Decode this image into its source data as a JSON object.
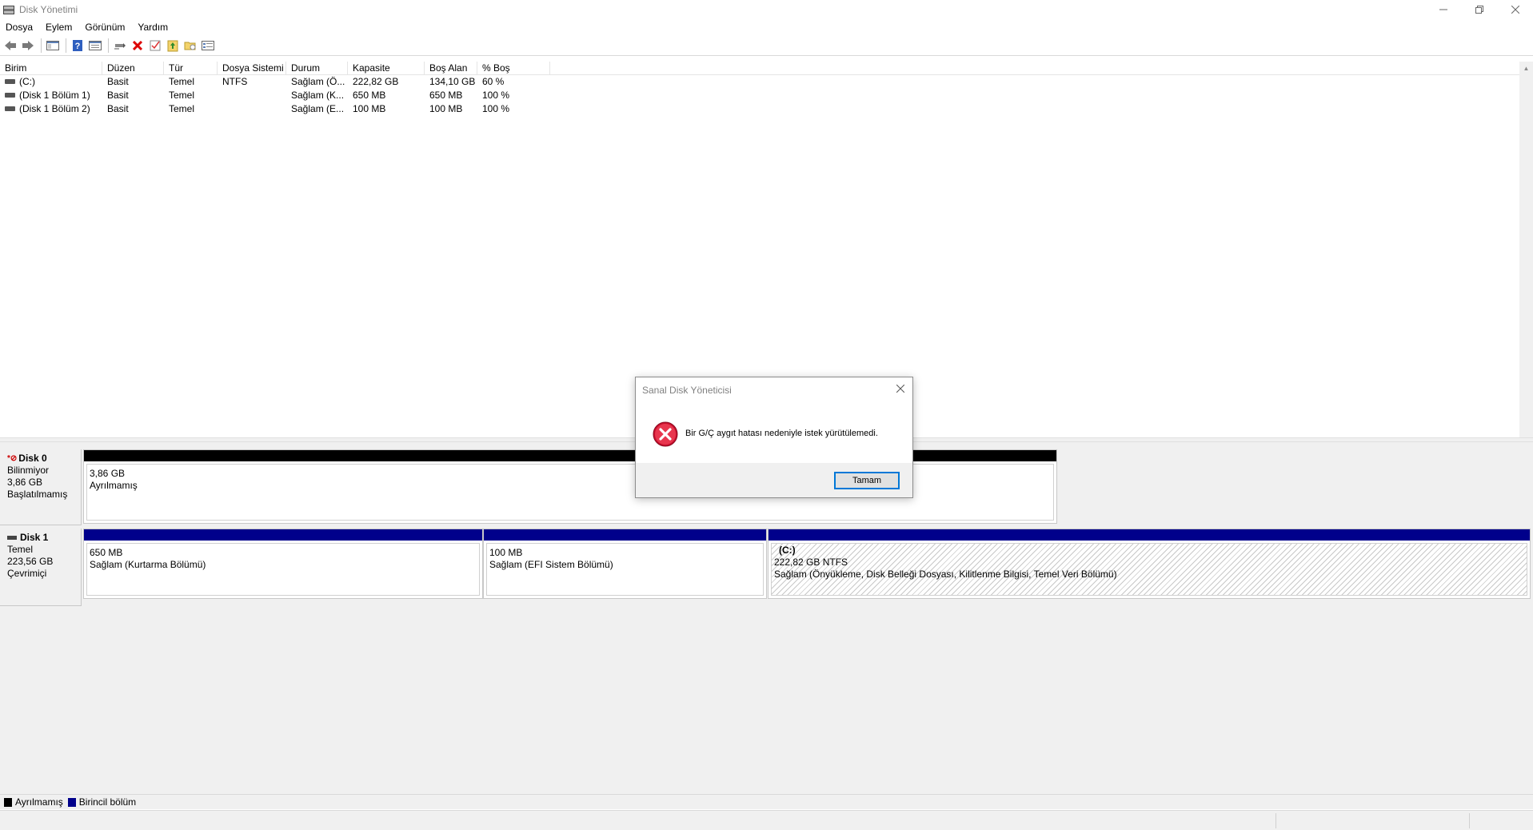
{
  "window": {
    "title": "Disk Yönetimi"
  },
  "menu": [
    "Dosya",
    "Eylem",
    "Görünüm",
    "Yardım"
  ],
  "toolbar": {
    "icons": [
      "back-arrow-icon",
      "forward-arrow-icon",
      "console-tree-icon",
      "help-icon",
      "properties-icon",
      "connect-icon",
      "delete-icon",
      "check-icon",
      "export-icon",
      "folder-icon",
      "list-view-icon"
    ]
  },
  "volume_list": {
    "columns": [
      "Birim",
      "Düzen",
      "Tür",
      "Dosya Sistemi",
      "Durum",
      "Kapasite",
      "Boş Alan",
      "% Boş"
    ],
    "rows": [
      [
        "(C:)",
        "Basit",
        "Temel",
        "NTFS",
        "Sağlam (Ö...",
        "222,82 GB",
        "134,10 GB",
        "60 %"
      ],
      [
        "(Disk 1 Bölüm 1)",
        "Basit",
        "Temel",
        "",
        "Sağlam (K...",
        "650 MB",
        "650 MB",
        "100 %"
      ],
      [
        "(Disk 1 Bölüm 2)",
        "Basit",
        "Temel",
        "",
        "Sağlam (E...",
        "100 MB",
        "100 MB",
        "100 %"
      ]
    ]
  },
  "disks": [
    {
      "name": "Disk 0",
      "type": "Bilinmiyor",
      "size": "3,86 GB",
      "status": "Başlatılmamış",
      "partitions": [
        {
          "size": "3,86 GB",
          "label": "Ayrılmamış",
          "bar_color": "#000000"
        }
      ]
    },
    {
      "name": "Disk 1",
      "type": "Temel",
      "size": "223,56 GB",
      "status": "Çevrimiçi",
      "partitions": [
        {
          "size": "650 MB",
          "label": "Sağlam (Kurtarma Bölümü)",
          "bar_color": "#00008b"
        },
        {
          "size": "100 MB",
          "label": "Sağlam (EFI Sistem Bölümü)",
          "bar_color": "#00008b"
        },
        {
          "name": "(C:)",
          "size": "222,82 GB NTFS",
          "label": "Sağlam (Önyükleme, Disk Belleği Dosyası, Kilitlenme Bilgisi, Temel Veri Bölümü)",
          "bar_color": "#00008b"
        }
      ]
    }
  ],
  "legend": [
    {
      "label": "Ayrılmamış",
      "color": "#000000"
    },
    {
      "label": "Birincil bölüm",
      "color": "#00008b"
    }
  ],
  "dialog": {
    "title": "Sanal Disk Yöneticisi",
    "message": "Bir G/Ç aygıt hatası nedeniyle istek yürütülemedi.",
    "ok_label": "Tamam",
    "icon": "error-icon"
  }
}
